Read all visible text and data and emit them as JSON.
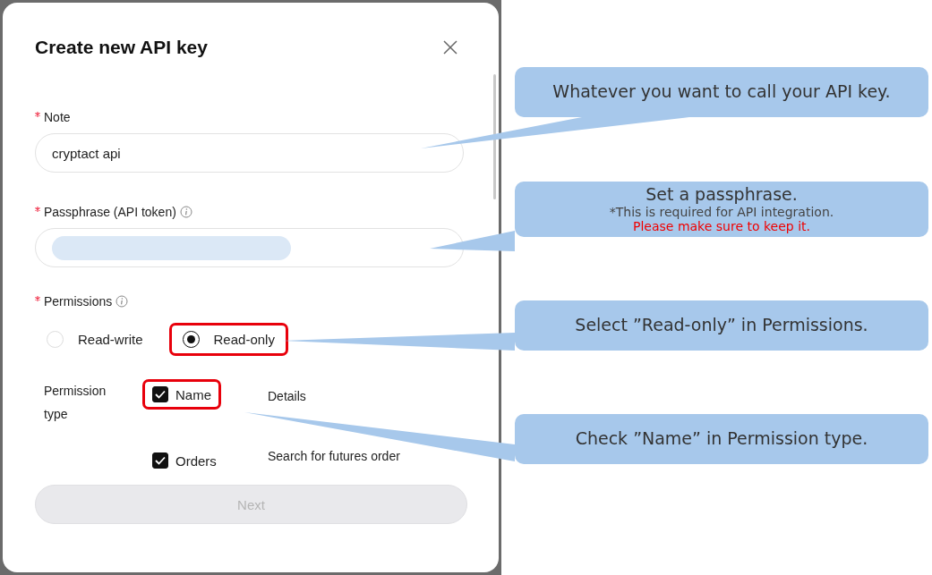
{
  "dialog": {
    "title": "Create new API key",
    "fields": [
      {
        "label": "Note",
        "required": true,
        "info": false,
        "kind": "text",
        "value": "cryptact api"
      },
      {
        "label": "Passphrase (API token)",
        "required": true,
        "info": true,
        "kind": "redacted"
      }
    ],
    "permissions": {
      "label": "Permissions",
      "required": true,
      "info": true,
      "options": [
        {
          "label": "Read-write",
          "selected": false,
          "highlighted": false
        },
        {
          "label": "Read-only",
          "selected": true,
          "highlighted": true
        }
      ]
    },
    "permission_type": {
      "label": "Permission type",
      "items": [
        {
          "label": "Name",
          "checked": true,
          "highlighted": true,
          "description": "Details"
        },
        {
          "label": "Orders",
          "checked": true,
          "highlighted": false,
          "description": "Search for futures order"
        }
      ]
    },
    "next_button": {
      "label": "Next",
      "disabled": true
    }
  },
  "callouts": [
    {
      "lines": [
        {
          "kind": "main",
          "text": "Whatever you want to call your API key."
        }
      ]
    },
    {
      "lines": [
        {
          "kind": "main",
          "text": "Set a passphrase."
        },
        {
          "kind": "note",
          "text": "*This is required for API integration."
        },
        {
          "kind": "warning",
          "text": "Please make sure to keep it."
        }
      ]
    },
    {
      "lines": [
        {
          "kind": "main",
          "text": "Select ”Read-only” in Permissions."
        }
      ]
    },
    {
      "lines": [
        {
          "kind": "main",
          "text": "Check ”Name” in Permission type."
        }
      ]
    }
  ]
}
